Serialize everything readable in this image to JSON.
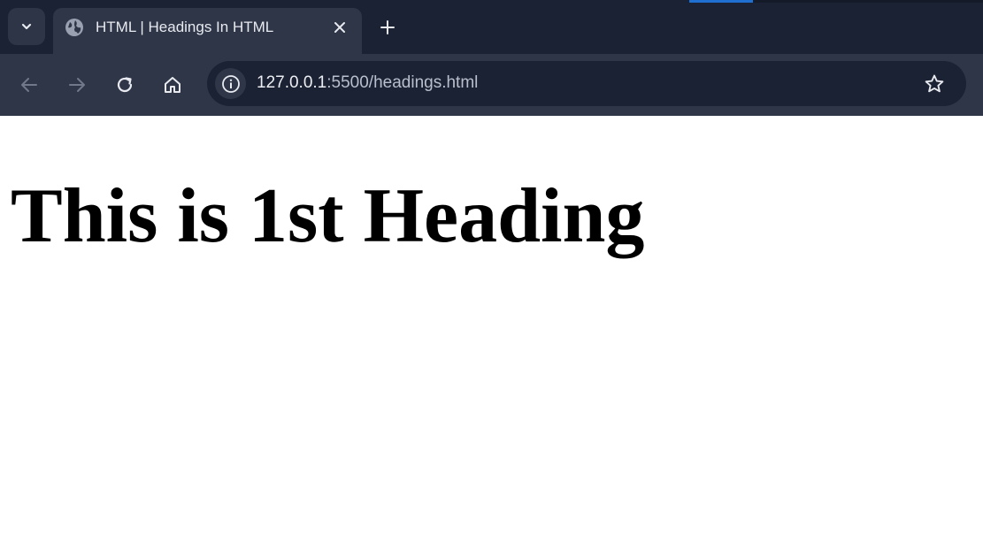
{
  "browser": {
    "tab": {
      "title": "HTML | Headings In HTML",
      "favicon": "globe-icon"
    },
    "toolbar": {
      "back_icon": "arrow-left-icon",
      "forward_icon": "arrow-right-icon",
      "reload_icon": "reload-icon",
      "home_icon": "home-icon"
    },
    "address_bar": {
      "host": "127.0.0.1",
      "rest": ":5500/headings.html",
      "site_info_icon": "info-icon",
      "bookmark_icon": "star-icon"
    },
    "colors": {
      "tab_strip": "#1b2233",
      "toolbar": "#2e3648",
      "accent": "#1f6fd1"
    }
  },
  "page": {
    "heading": "This is 1st Heading"
  }
}
